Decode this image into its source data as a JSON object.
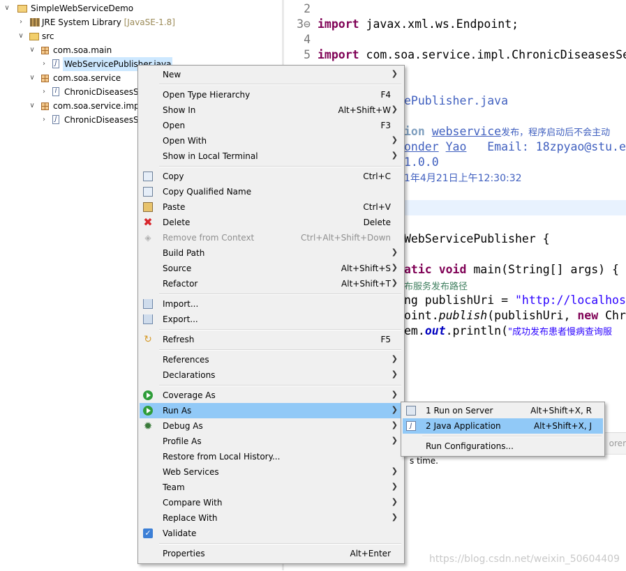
{
  "tree": {
    "nodes": [
      {
        "twisty": "v",
        "icon": "project-icon",
        "label": "SimpleWebServiceDemo"
      },
      {
        "twisty": ">",
        "icon": "library-icon",
        "label": "JRE System Library",
        "version": "[JavaSE-1.8]"
      },
      {
        "twisty": "v",
        "icon": "source-folder-icon",
        "label": "src"
      },
      {
        "twisty": "v",
        "icon": "package-icon",
        "label": "com.soa.main"
      },
      {
        "twisty": ">",
        "icon": "java-file-icon",
        "label": "WebServicePublisher.java"
      },
      {
        "twisty": "v",
        "icon": "package-icon",
        "label": "com.soa.service"
      },
      {
        "twisty": ">",
        "icon": "java-interface-icon",
        "label": "ChronicDiseasesSe"
      },
      {
        "twisty": "v",
        "icon": "package-icon",
        "label": "com.soa.service.impl"
      },
      {
        "twisty": ">",
        "icon": "java-file-icon",
        "label": "ChronicDiseasesSe"
      }
    ]
  },
  "editor": {
    "line_numbers": [
      "2",
      "3⊖",
      "4",
      "5"
    ],
    "import_kw": "import",
    "import1_rest": " javax.xml.ws.Endpoint;",
    "import2_rest": " com.soa.service.impl.ChronicDiseasesSe",
    "jd_file": "ePublisher.java",
    "jd_line1_tag": "ion",
    "jd_line1_ws": "webservice",
    "jd_line1_cn": "发布，程序启动后不会主动",
    "jd_line2_a": "onder",
    "jd_line2_b": "Yao",
    "jd_line2_c": "Email: 18zpyao@stu.e",
    "jd_line3": "1.0.0",
    "jd_line4": "1年4月21日上午12:30:32",
    "class_line": "WebServicePublisher {",
    "main_kw1": "atic",
    "main_kw2": "void",
    "main_rest": " main(String[] args) {",
    "comment_cn": "布服务发布路径",
    "uri_a": "ng publishUri = ",
    "uri_str": "\"http://localhos",
    "publish_a": "oint.",
    "publish_b": "publish",
    "publish_c": "(publishUri, ",
    "publish_new": "new",
    "publish_d": " Chr",
    "println_a": "em.",
    "println_out": "out",
    "println_b": ".println(",
    "println_str": "\"成功发布患者慢病查询服"
  },
  "bottom_panel": {
    "tab_fragment": "orer",
    "message_fragment": "s time."
  },
  "watermark": "https://blog.csdn.net/weixin_50604409",
  "context_menu": {
    "items": [
      {
        "label": "New",
        "key": "",
        "submenu": true
      },
      {
        "separator": true
      },
      {
        "label": "Open Type Hierarchy",
        "key": "F4"
      },
      {
        "label": "Show In",
        "key": "Alt+Shift+W",
        "submenu": true
      },
      {
        "label": "Open",
        "key": "F3"
      },
      {
        "label": "Open With",
        "key": "",
        "submenu": true
      },
      {
        "label": "Show in Local Terminal",
        "key": "",
        "submenu": true
      },
      {
        "separator": true
      },
      {
        "label": "Copy",
        "key": "Ctrl+C",
        "icon": "copy-icon"
      },
      {
        "label": "Copy Qualified Name",
        "key": "",
        "icon": "copy-qualified-icon"
      },
      {
        "label": "Paste",
        "key": "Ctrl+V",
        "icon": "paste-icon"
      },
      {
        "label": "Delete",
        "key": "Delete",
        "icon": "delete-icon"
      },
      {
        "label": "Remove from Context",
        "key": "Ctrl+Alt+Shift+Down",
        "icon": "remove-context-icon",
        "disabled": true
      },
      {
        "label": "Build Path",
        "key": "",
        "submenu": true
      },
      {
        "label": "Source",
        "key": "Alt+Shift+S",
        "submenu": true
      },
      {
        "label": "Refactor",
        "key": "Alt+Shift+T",
        "submenu": true
      },
      {
        "separator": true
      },
      {
        "label": "Import...",
        "key": "",
        "icon": "import-icon"
      },
      {
        "label": "Export...",
        "key": "",
        "icon": "export-icon"
      },
      {
        "separator": true
      },
      {
        "label": "Refresh",
        "key": "F5",
        "icon": "refresh-icon"
      },
      {
        "separator": true
      },
      {
        "label": "References",
        "key": "",
        "submenu": true
      },
      {
        "label": "Declarations",
        "key": "",
        "submenu": true
      },
      {
        "separator": true
      },
      {
        "label": "Coverage As",
        "key": "",
        "submenu": true,
        "icon": "coverage-icon"
      },
      {
        "label": "Run As",
        "key": "",
        "submenu": true,
        "icon": "run-icon",
        "active": true
      },
      {
        "label": "Debug As",
        "key": "",
        "submenu": true,
        "icon": "debug-bug-icon"
      },
      {
        "label": "Profile As",
        "key": "",
        "submenu": true
      },
      {
        "label": "Restore from Local History...",
        "key": ""
      },
      {
        "label": "Web Services",
        "key": "",
        "submenu": true
      },
      {
        "label": "Team",
        "key": "",
        "submenu": true
      },
      {
        "label": "Compare With",
        "key": "",
        "submenu": true
      },
      {
        "label": "Replace With",
        "key": "",
        "submenu": true
      },
      {
        "label": "Validate",
        "key": "",
        "icon": "validate-check-icon"
      },
      {
        "separator": true
      },
      {
        "label": "Properties",
        "key": "Alt+Enter"
      }
    ]
  },
  "run_as_submenu": {
    "items": [
      {
        "label": "1 Run on Server",
        "key": "Alt+Shift+X, R",
        "icon": "server-icon"
      },
      {
        "label": "2 Java Application",
        "key": "Alt+Shift+X, J",
        "icon": "java-app-icon",
        "active": true
      },
      {
        "separator": true
      },
      {
        "label": "Run Configurations...",
        "key": ""
      }
    ]
  },
  "colors": {
    "menu_highlight": "#91c9f7",
    "selection": "#cde8ff",
    "keyword": "#7f0055",
    "javadoc": "#3f5fbf",
    "string": "#2a00ff"
  }
}
